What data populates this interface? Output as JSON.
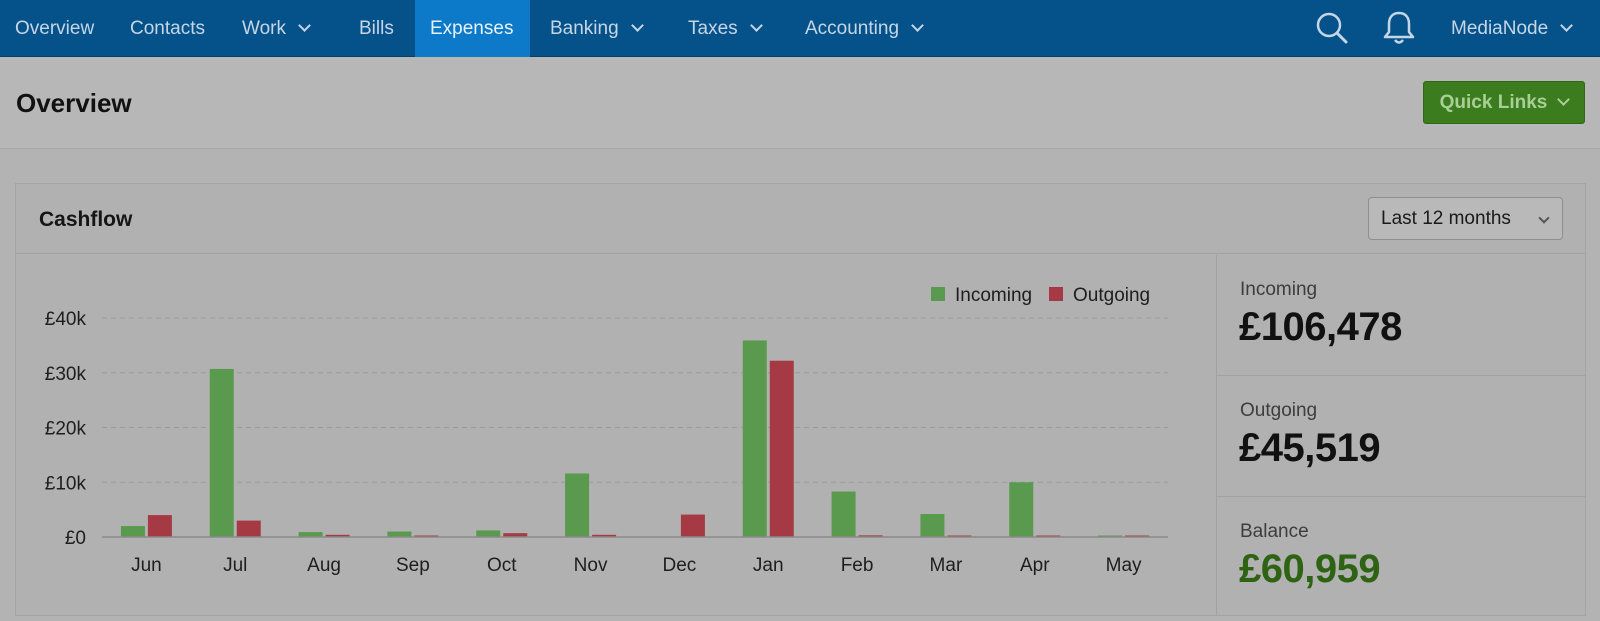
{
  "nav": {
    "items": [
      {
        "label": "Overview",
        "dropdown": false
      },
      {
        "label": "Contacts",
        "dropdown": false
      },
      {
        "label": "Work",
        "dropdown": true
      },
      {
        "label": "Bills",
        "dropdown": false
      },
      {
        "label": "Expenses",
        "dropdown": false,
        "active": true
      },
      {
        "label": "Banking",
        "dropdown": true
      },
      {
        "label": "Taxes",
        "dropdown": true
      },
      {
        "label": "Accounting",
        "dropdown": true
      }
    ],
    "icons": [
      "search-icon",
      "bell-icon"
    ],
    "account_label": "MediaNode"
  },
  "header": {
    "title": "Overview",
    "quick_links_label": "Quick Links"
  },
  "cashflow": {
    "title": "Cashflow",
    "period_selected": "Last 12 months",
    "stats": {
      "incoming_label": "Incoming",
      "incoming_value": "£106,478",
      "outgoing_label": "Outgoing",
      "outgoing_value": "£45,519",
      "balance_label": "Balance",
      "balance_value": "£60,959"
    }
  },
  "colors": {
    "incoming": "#5a9a4e",
    "outgoing": "#a63a44",
    "nav_bg": "#05528a",
    "nav_active": "#0c7ac8",
    "balance_positive": "#2d6313"
  },
  "chart_data": {
    "type": "bar",
    "categories": [
      "Jun",
      "Jul",
      "Aug",
      "Sep",
      "Oct",
      "Nov",
      "Dec",
      "Jan",
      "Feb",
      "Mar",
      "Apr",
      "May"
    ],
    "series": [
      {
        "name": "Incoming",
        "values": [
          2000,
          30700,
          900,
          1000,
          1200,
          11600,
          0,
          35900,
          8300,
          4200,
          10000,
          100
        ]
      },
      {
        "name": "Outgoing",
        "values": [
          4000,
          3000,
          400,
          100,
          700,
          400,
          4100,
          32200,
          300,
          100,
          100,
          100
        ]
      }
    ],
    "yticks": [
      "£0",
      "£10k",
      "£20k",
      "£30k",
      "£40k"
    ],
    "ylim": [
      0,
      40000
    ],
    "grid": true,
    "legend_position": "top-right"
  }
}
